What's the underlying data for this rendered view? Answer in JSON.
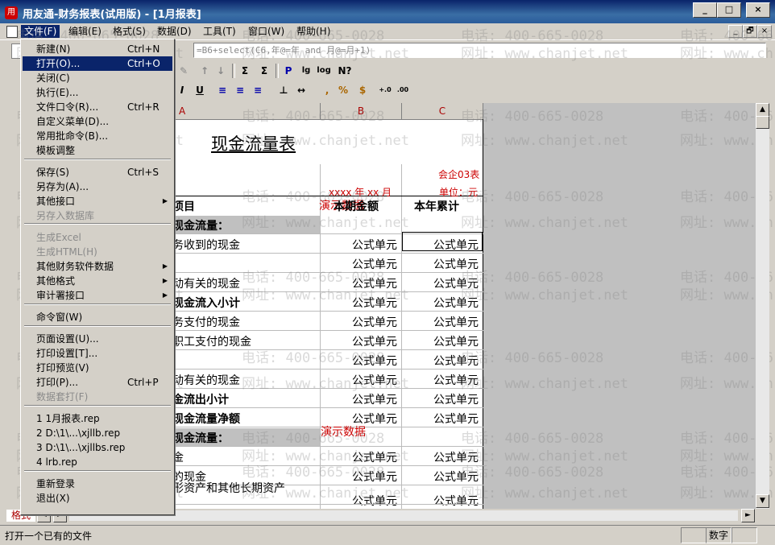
{
  "window": {
    "title": "用友通-财务报表(试用版) - [1月报表]",
    "minimize": "_",
    "maximize": "□",
    "close": "×"
  },
  "menubar": {
    "items": [
      "文件(F)",
      "编辑(E)",
      "格式(S)",
      "数据(D)",
      "工具(T)",
      "窗口(W)",
      "帮助(H)"
    ],
    "mdi_restore": "🗗",
    "mdi_close": "×"
  },
  "toolbar": {
    "formula": "=B6+select(C6,年@=年 and 月@=月+1)",
    "buttons": [
      "Σ",
      "Σ",
      "P",
      "lg",
      "log",
      "N?",
      "I",
      "U",
      "%",
      "$",
      ",",
      "+.0",
      ".00"
    ]
  },
  "file_menu": {
    "items": [
      {
        "label": "新建(N)",
        "shortcut": "Ctrl+N"
      },
      {
        "label": "打开(O)...",
        "shortcut": "Ctrl+O",
        "highlighted": true
      },
      {
        "label": "关闭(C)"
      },
      {
        "label": "执行(E)..."
      },
      {
        "label": "文件口令(R)...",
        "shortcut": "Ctrl+R"
      },
      {
        "label": "自定义菜单(D)..."
      },
      {
        "label": "常用批命令(B)..."
      },
      {
        "label": "模板调整"
      },
      {
        "label": "保存(S)",
        "shortcut": "Ctrl+S"
      },
      {
        "label": "另存为(A)..."
      },
      {
        "label": "其他接口",
        "submenu": true
      },
      {
        "label": "另存入数据库",
        "disabled": true
      },
      {
        "label": "生成Excel",
        "disabled": true
      },
      {
        "label": "生成HTML(H)",
        "disabled": true
      },
      {
        "label": "其他财务软件数据",
        "submenu": true
      },
      {
        "label": "其他格式",
        "submenu": true
      },
      {
        "label": "审计署接口",
        "submenu": true
      },
      {
        "label": "命令窗(W)"
      },
      {
        "label": "页面设置(U)..."
      },
      {
        "label": "打印设置[T]..."
      },
      {
        "label": "打印预览(V)"
      },
      {
        "label": "打印(P)...",
        "shortcut": "Ctrl+P"
      },
      {
        "label": "数据套打(F)",
        "disabled": true
      },
      {
        "label": "1 1月报表.rep"
      },
      {
        "label": "2 D:\\1\\...\\xjllb.rep"
      },
      {
        "label": "3 D:\\1\\...\\xjllbs.rep"
      },
      {
        "label": "4 lrb.rep"
      },
      {
        "label": "重新登录"
      },
      {
        "label": "退出(X)"
      }
    ]
  },
  "sheet": {
    "columns": [
      "A",
      "B",
      "C"
    ],
    "title": "现金流量表",
    "form_code": "会企03表",
    "period": "xxxx 年 xx 月",
    "unit": "单位：元",
    "demo_label": "演示数据",
    "header_item": "项目",
    "header_current": "本期金额",
    "header_ytd": "本年累计",
    "formula_cell": "公式单元",
    "rows": [
      "现金流量：",
      "务收到的现金",
      "",
      "动有关的现金",
      "现金流入小计",
      "务支付的现金",
      "职工支付的现金",
      "",
      "动有关的现金",
      "金流出小计",
      "现金流量净额",
      "现金流量：",
      "金",
      "的现金",
      "形资产和其他长期资产"
    ]
  },
  "sheet_tab": "格式",
  "status": {
    "text": "打开一个已有的文件",
    "mode": "数字"
  },
  "watermark": {
    "phone": "电话: 400-665-0028",
    "url": "网址: www.chanjet.net"
  }
}
